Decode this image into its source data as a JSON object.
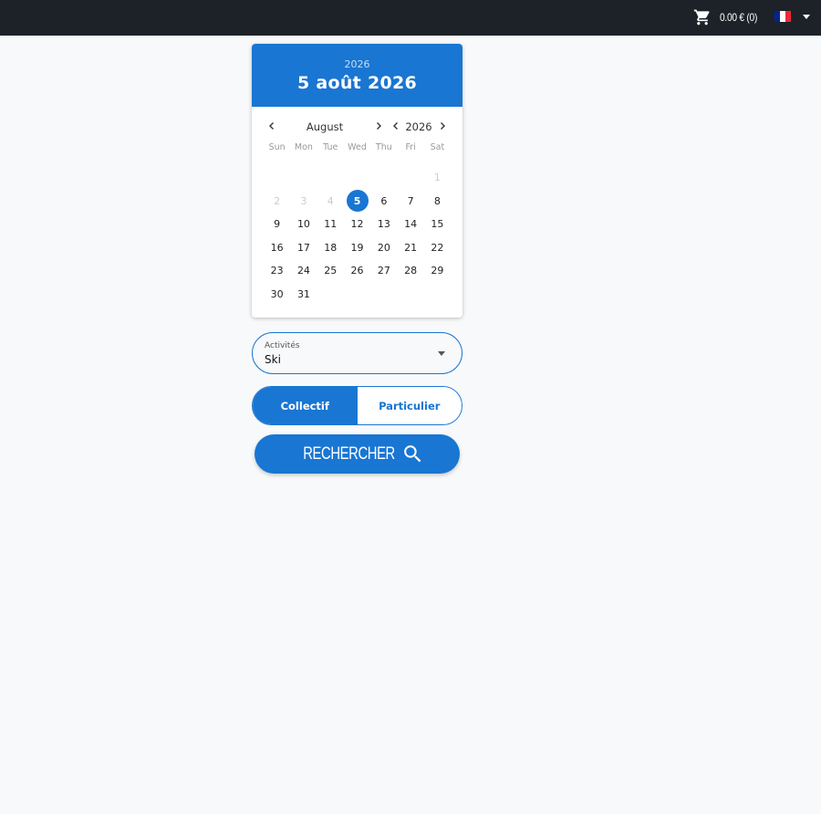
{
  "header": {
    "cart_total": "0.00 € (0)",
    "cart_icon": "shopping-cart-icon",
    "language_flag": "fr-flag-icon",
    "flag_colors": [
      "#002395",
      "#ffffff",
      "#ed2939"
    ]
  },
  "datepicker": {
    "header_year": "2026",
    "header_date": "5 août 2026",
    "nav_month": "August",
    "nav_year": "2026",
    "weekdays": [
      "Sun",
      "Mon",
      "Tue",
      "Wed",
      "Thu",
      "Fri",
      "Sat"
    ],
    "leading_blanks": 6,
    "days": [
      "1",
      "2",
      "3",
      "4",
      "5",
      "6",
      "7",
      "8",
      "9",
      "10",
      "11",
      "12",
      "13",
      "14",
      "15",
      "16",
      "17",
      "18",
      "19",
      "20",
      "21",
      "22",
      "23",
      "24",
      "25",
      "26",
      "27",
      "28",
      "29",
      "30",
      "31"
    ],
    "disabled_days": [
      "1",
      "2",
      "3",
      "4"
    ],
    "selected_day": "5"
  },
  "activity": {
    "label": "Activités",
    "value": "Ski"
  },
  "lesson_type": {
    "option_1": "Collectif",
    "option_2": "Particulier",
    "selected": "Collectif"
  },
  "search": {
    "label": "RECHERCHER",
    "icon": "search-icon"
  },
  "colors": {
    "accent": "#1976d2",
    "topbar": "#1c2228",
    "background": "#f8f9fa"
  }
}
